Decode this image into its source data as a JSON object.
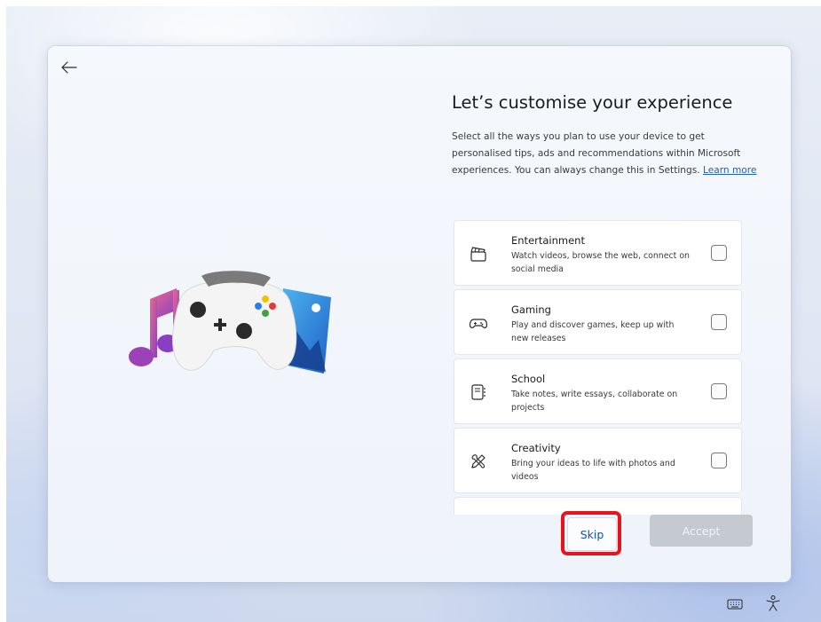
{
  "window": {
    "title": "Let’s customise your experience",
    "description": "Select all the ways you plan to use your device to get personalised tips, ads and recommendations within Microsoft experiences. You can always change this in Settings.",
    "learn_more_label": "Learn more",
    "back_icon": "arrow-left-icon",
    "hero_illustration": "music-note, game-controller, photo"
  },
  "options": [
    {
      "title": "Entertainment",
      "description": "Watch videos, browse the web, connect on social media",
      "icon": "clapperboard-icon",
      "checked": false
    },
    {
      "title": "Gaming",
      "description": "Play and discover games, keep up with new releases",
      "icon": "gamepad-icon",
      "checked": false
    },
    {
      "title": "School",
      "description": "Take notes, write essays, collaborate on projects",
      "icon": "notebook-icon",
      "checked": false
    },
    {
      "title": "Creativity",
      "description": "Bring your ideas to life with photos and videos",
      "icon": "pen-brush-icon",
      "checked": false
    }
  ],
  "buttons": {
    "skip_label": "Skip",
    "accept_label": "Accept",
    "accept_enabled": false
  },
  "tray": {
    "keyboard_icon": "keyboard-icon",
    "accessibility_icon": "accessibility-icon"
  },
  "colors": {
    "highlight": "#e8141c",
    "link": "#1f5fbf",
    "accept_disabled": "#c5c9d0"
  }
}
